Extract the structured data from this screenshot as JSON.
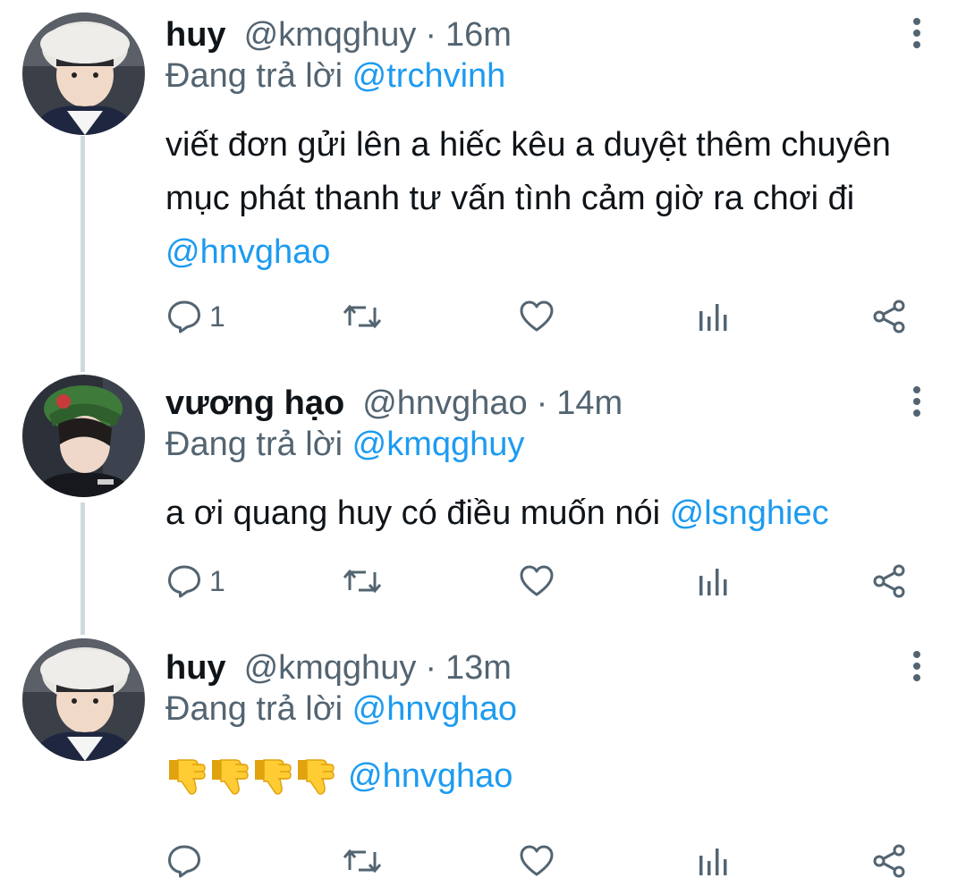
{
  "tweets": [
    {
      "name": "huy",
      "handle": "@kmqghuy",
      "separator": "·",
      "time": "16m",
      "replying_prefix": "Đang trả lời",
      "replying_to": "@trchvinh",
      "text_line1": "viết đơn gửi lên a hiếc kêu a duyệt thêm chuyên",
      "text_line2": "mục phát thanh tư vấn tình cảm giờ ra chơi đi",
      "text_mention": "@hnvghao",
      "reply_count": "1"
    },
    {
      "name": "vương hạo",
      "handle": "@hnvghao",
      "separator": "·",
      "time": "14m",
      "replying_prefix": "Đang trả lời",
      "replying_to": "@kmqghuy",
      "text_line1": "a ơi quang huy có điều muốn nói",
      "text_mention": "@lsnghiec",
      "reply_count": "1"
    },
    {
      "name": "huy",
      "handle": "@kmqghuy",
      "separator": "·",
      "time": "13m",
      "replying_prefix": "Đang trả lời",
      "replying_to": "@hnvghao",
      "emoji_count": 4,
      "emoji_name": "thumbs-down",
      "text_mention": "@hnvghao",
      "reply_count": ""
    }
  ],
  "colors": {
    "text": "#0f1419",
    "secondary": "#536471",
    "link": "#1d9bf0",
    "icon": "#536471",
    "thread_line": "#cfd9de"
  },
  "icons": [
    "reply-icon",
    "retweet-icon",
    "like-icon",
    "analytics-icon",
    "share-icon",
    "more-icon"
  ]
}
